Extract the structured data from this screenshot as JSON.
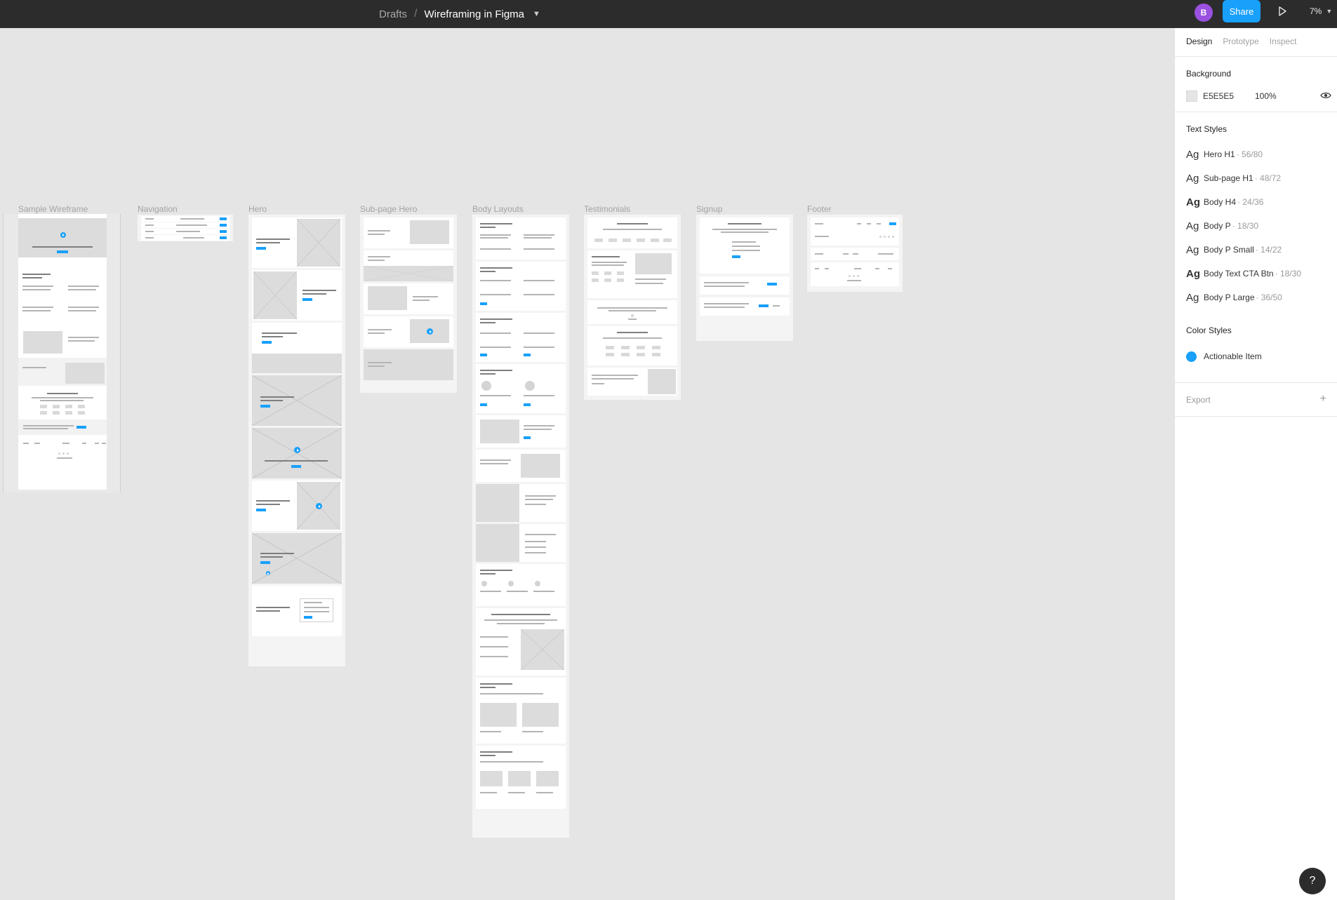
{
  "topbar": {
    "breadcrumb_root": "Drafts",
    "breadcrumb_sep": "/",
    "file_name": "Wireframing in Figma",
    "avatar_initial": "B",
    "share_label": "Share",
    "zoom": "7%"
  },
  "frames": {
    "sample_wireframe": "Sample Wireframe",
    "navigation": "Navigation",
    "hero": "Hero",
    "subpage_hero": "Sub-page Hero",
    "body_layouts": "Body Layouts",
    "testimonials": "Testimonials",
    "signup": "Signup",
    "footer": "Footer"
  },
  "panel": {
    "tabs": [
      "Design",
      "Prototype",
      "Inspect"
    ],
    "background_title": "Background",
    "background_hex": "E5E5E5",
    "background_opacity": "100%",
    "text_styles_title": "Text Styles",
    "text_styles": [
      {
        "ag": "Ag",
        "name": "Hero H1",
        "spec": "· 56/80"
      },
      {
        "ag": "Ag",
        "name": "Sub-page H1",
        "spec": "· 48/72"
      },
      {
        "ag": "Ag",
        "name": "Body H4",
        "spec": "· 24/36"
      },
      {
        "ag": "Ag",
        "name": "Body P",
        "spec": "· 18/30"
      },
      {
        "ag": "Ag",
        "name": "Body P Small",
        "spec": "· 14/22"
      },
      {
        "ag": "Ag",
        "name": "Body Text CTA Btn",
        "spec": "· 18/30"
      },
      {
        "ag": "Ag",
        "name": "Body P Large",
        "spec": "· 36/50"
      }
    ],
    "color_styles_title": "Color Styles",
    "color_style_name": "Actionable Item",
    "export_label": "Export",
    "help": "?"
  },
  "colors": {
    "canvas": "#E5E5E5",
    "topbar": "#2C2C2C",
    "accent": "#18A0FB",
    "avatar": "#9B51E0"
  },
  "icons": [
    "chevron-down-icon",
    "play-icon",
    "eye-icon",
    "plus-icon",
    "play-circle-icon",
    "help-icon"
  ]
}
